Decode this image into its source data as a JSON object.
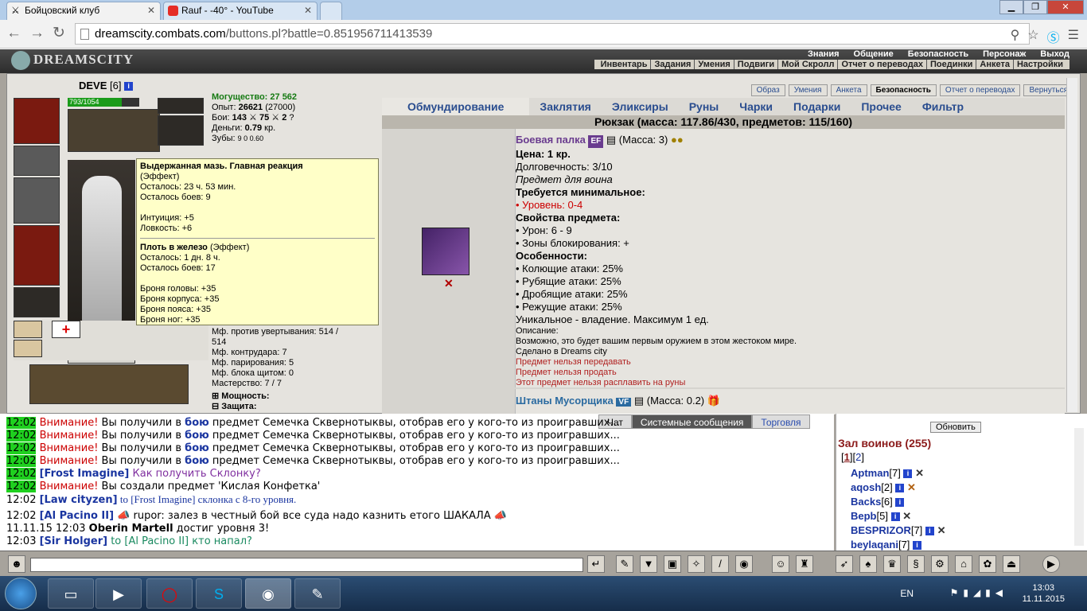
{
  "browser": {
    "tabs": [
      {
        "title": "Бойцовский клуб",
        "active": true
      },
      {
        "title": "Rauf - -40° - YouTube",
        "active": false
      }
    ],
    "url_domain": "dreamscity.combats.com",
    "url_path": "/buttons.pl?battle=0.851956711413539"
  },
  "game": {
    "logo": "DREAMSCITY",
    "menu_top": [
      "Знания",
      "Общение",
      "Безопасность",
      "Персонаж",
      "Выход"
    ],
    "menu_sub": [
      "Инвентарь",
      "Задания",
      "Умения",
      "Подвиги",
      "Мой Скролл",
      "Отчет о переводах",
      "Поединки",
      "Анкета",
      "Настройки"
    ],
    "character": {
      "name": "DEVE",
      "level": "[6]",
      "hp": "793/1054",
      "hp_fraction": 0.75
    },
    "stats": {
      "power": "Могущество: 27 562",
      "exp_label": "Опыт:",
      "exp": "26621",
      "exp_next": "(27000)",
      "fights_label": "Бои:",
      "fights_won": "143",
      "fights_lost": "75",
      "fights_draw": "2",
      "money_label": "Деньги:",
      "money": "0.79",
      "money_unit": "кр.",
      "teeth_label": "Зубы:",
      "teeth": "9  0  0.60"
    },
    "stats_lower": [
      "Мф. против увертывания: 514 /",
      "514",
      "Мф. контрудара: 7",
      "Мф. парирования: 5",
      "Мф. блока щитом: 0",
      "Мастерство: 7 / 7"
    ],
    "sections": [
      "Мощность:",
      "Защита:"
    ],
    "tooltip": {
      "effect1_title": "Выдержанная мазь. Главная реакция",
      "effect1_type": "(Эффект)",
      "effect1_lines": [
        "Осталось: 23 ч. 53 мин.",
        "Осталось боев: 9",
        "",
        "Интуиция: +5",
        "Ловкость: +6"
      ],
      "effect2_title": "Плоть в железо",
      "effect2_type": "(Эффект)",
      "effect2_lines": [
        "Осталось: 1 дн. 8 ч.",
        "Осталось боев: 17",
        "",
        "Броня головы: +35",
        "Броня корпуса: +35",
        "Броня пояса: +35",
        "Броня ног: +35"
      ]
    },
    "top_tabs": [
      "Образ",
      "Умения",
      "Анкета",
      "Безопасность",
      "Отчет о переводах",
      "Вернуться"
    ],
    "inv_tabs": [
      "Обмундирование",
      "Заклятия",
      "Эликсиры",
      "Руны",
      "Чарки",
      "Подарки",
      "Прочее",
      "Фильтр"
    ],
    "inv_header": "Рюкзак (масса: 117.86/430, предметов: 115/160)",
    "item1": {
      "name": "Боевая палка",
      "badge": "EF",
      "mass": "(Масса: 3)",
      "price": "Цена: 1 кр.",
      "durability": "Долговечность: 3/10",
      "for": "Предмет для воина",
      "req_title": "Требуется минимальное:",
      "req_level": "• Уровень: 0-4",
      "props_title": "Свойства предмета:",
      "props": [
        "• Урон: 6 - 9",
        "• Зоны блокирования: +"
      ],
      "feat_title": "Особенности:",
      "feats": [
        "• Колющие атаки: 25%",
        "• Рубящие атаки: 25%",
        "• Дробящие атаки: 25%",
        "• Режущие атаки: 25%"
      ],
      "unique": "Уникальное - владение. Максимум 1 ед.",
      "desc_label": "Описание:",
      "desc": "Возможно, это будет вашим первым оружием в этом жестоком мире.",
      "made": "Сделано в Dreams city",
      "restrictions": [
        "Предмет нельзя передавать",
        "Предмет нельзя продать",
        "Этот предмет нельзя расплавить на руны"
      ]
    },
    "item2": {
      "name": "Штаны Мусорщика",
      "badge": "VF",
      "mass": "(Масса: 0.2)"
    }
  },
  "chat": {
    "tabs": [
      "Чат",
      "Системные сообщения",
      "Торговля"
    ],
    "lines": [
      {
        "time": "12:02",
        "who": "Внимание!",
        "text": " Вы получили в ",
        "bold": "бою",
        "rest": " предмет Семечка Сквернотыквы, отобрав его у кого-то из проигравших..."
      },
      {
        "time": "12:02",
        "who": "Внимание!",
        "text": " Вы получили в ",
        "bold": "бою",
        "rest": " предмет Семечка Сквернотыквы, отобрав его у кого-то из проигравших..."
      },
      {
        "time": "12:02",
        "who": "Внимание!",
        "text": " Вы получили в ",
        "bold": "бою",
        "rest": " предмет Семечка Сквернотыквы, отобрав его у кого-то из проигравших..."
      },
      {
        "time": "12:02",
        "who": "Внимание!",
        "text": " Вы получили в ",
        "bold": "бою",
        "rest": " предмет Семечка Сквернотыквы, отобрав его у кого-то из проигравших..."
      }
    ],
    "line5": {
      "time": "12:02",
      "nick": "[Frost Imagine]",
      "text": " Как получить Склонку?"
    },
    "line6": {
      "time": "12:02",
      "who": "Внимание!",
      "text": " Вы создали предмет 'Кислая Конфетка'"
    },
    "line7": {
      "time": "12:02",
      "nick": "[Law cityzen]",
      "text": " to [Frost Imagine] склонка с 8-го уровня."
    },
    "line8": {
      "time": "12:02",
      "nick": "[Al Pacino II]",
      "text": " rupor: залез в честный бой все суда надо казнить етого ШАКАЛА"
    },
    "line9": {
      "date": "11.11.15",
      "time": "12:03",
      "nick": "Oberin Martell",
      "text": " достиг уровня 3!"
    },
    "line10": {
      "time": "12:03",
      "nick": "[Sir Holger]",
      "text": " to [Al Pacino II] кто напал?"
    }
  },
  "online": {
    "refresh": "Обновить",
    "hall": "Зал воинов (255)",
    "page1": "1",
    "page2": "2",
    "players": [
      {
        "name": "Aptman",
        "level": "[7]",
        "x": "✕"
      },
      {
        "name": "aqosh",
        "level": "[2]",
        "x": "✕"
      },
      {
        "name": "Backs",
        "level": "[6]",
        "x": ""
      },
      {
        "name": "Bepb",
        "level": "[5]",
        "x": "✕"
      },
      {
        "name": "BESPRIZOR",
        "level": "[7]",
        "x": "✕"
      },
      {
        "name": "beylaqani",
        "level": "[7]",
        "x": ""
      }
    ]
  },
  "taskbar": {
    "lang": "EN",
    "time": "13:03",
    "date": "11.11.2015"
  }
}
